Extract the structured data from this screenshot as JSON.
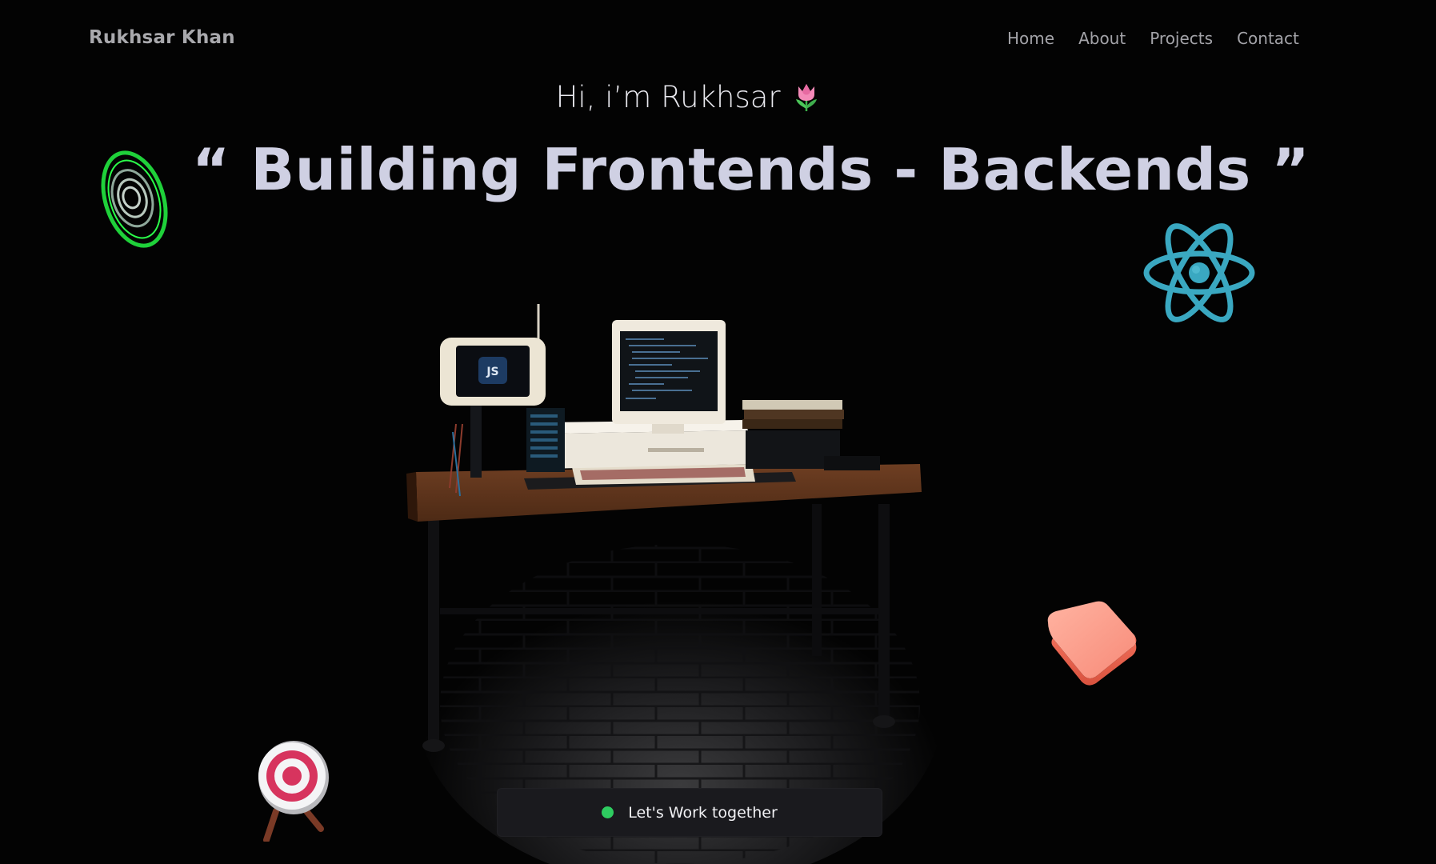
{
  "nav": {
    "brand": "Rukhsar Khan",
    "links": [
      {
        "label": "Home"
      },
      {
        "label": "About"
      },
      {
        "label": "Projects"
      },
      {
        "label": "Contact"
      }
    ]
  },
  "hero": {
    "greeting": "Hi, i’m Rukhsar",
    "greeting_icon": "tulip-icon",
    "headline_open_quote": "“",
    "headline": "Building Frontends - Backends",
    "headline_close_quote": "”"
  },
  "decorations": {
    "ring_icon": "green-rings-icon",
    "react_icon": "react-logo-icon",
    "cube_icon": "pink-cube-icon",
    "target_icon": "target-icon",
    "computer_icon": "js-mini-screen",
    "computer_screen_text": "JS"
  },
  "cta": {
    "label": "Let's Work together",
    "status_color": "#2ecc60"
  },
  "colors": {
    "background": "#030303",
    "headline": "#cfd0e3",
    "accent_green": "#2ecc60",
    "react_blue": "#3aa8c1",
    "cube_pink": "#f78a78"
  }
}
